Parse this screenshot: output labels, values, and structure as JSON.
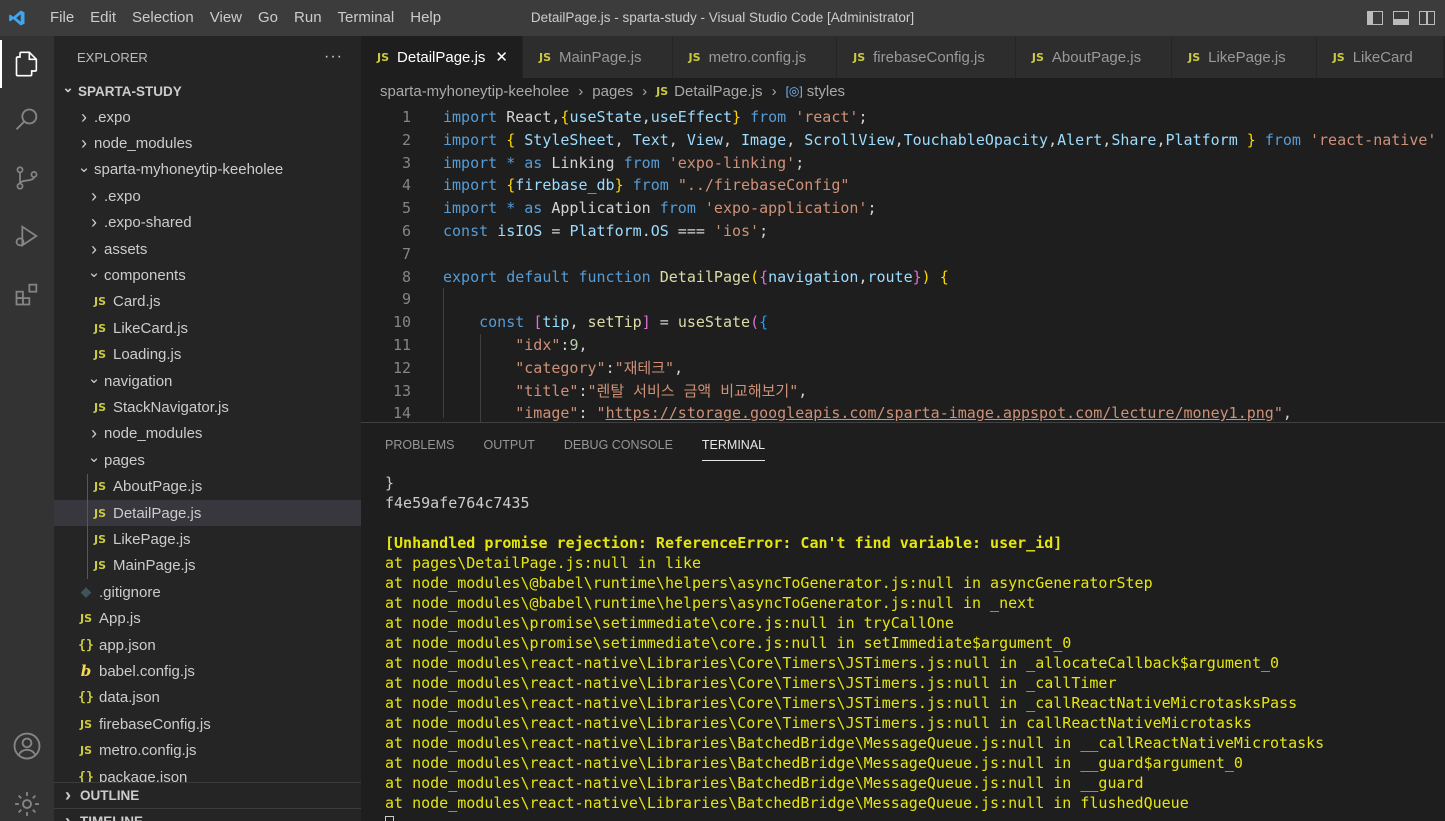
{
  "window": {
    "title": "DetailPage.js - sparta-study - Visual Studio Code [Administrator]",
    "menu": [
      "File",
      "Edit",
      "Selection",
      "View",
      "Go",
      "Run",
      "Terminal",
      "Help"
    ]
  },
  "explorer": {
    "header": "EXPLORER",
    "more": "···",
    "root": "SPARTA-STUDY",
    "items": [
      {
        "label": ".expo",
        "type": "folder"
      },
      {
        "label": "node_modules",
        "type": "folder"
      },
      {
        "label": "sparta-myhoneytip-keeholee",
        "type": "folder-open"
      },
      {
        "label": ".expo",
        "type": "folder"
      },
      {
        "label": ".expo-shared",
        "type": "folder"
      },
      {
        "label": "assets",
        "type": "folder"
      },
      {
        "label": "components",
        "type": "folder-open"
      },
      {
        "label": "Card.js",
        "type": "js"
      },
      {
        "label": "LikeCard.js",
        "type": "js"
      },
      {
        "label": "Loading.js",
        "type": "js"
      },
      {
        "label": "navigation",
        "type": "folder-open"
      },
      {
        "label": "StackNavigator.js",
        "type": "js"
      },
      {
        "label": "node_modules",
        "type": "folder"
      },
      {
        "label": "pages",
        "type": "folder-open"
      },
      {
        "label": "AboutPage.js",
        "type": "js"
      },
      {
        "label": "DetailPage.js",
        "type": "js"
      },
      {
        "label": "LikePage.js",
        "type": "js"
      },
      {
        "label": "MainPage.js",
        "type": "js"
      },
      {
        "label": ".gitignore",
        "type": "git"
      },
      {
        "label": "App.js",
        "type": "js"
      },
      {
        "label": "app.json",
        "type": "json"
      },
      {
        "label": "babel.config.js",
        "type": "babel"
      },
      {
        "label": "data.json",
        "type": "json"
      },
      {
        "label": "firebaseConfig.js",
        "type": "js"
      },
      {
        "label": "metro.config.js",
        "type": "js"
      },
      {
        "label": "package.json",
        "type": "json"
      }
    ],
    "outline": "OUTLINE",
    "timeline": "TIMELINE"
  },
  "tabs": [
    {
      "label": "DetailPage.js",
      "icon": "JS",
      "close": "✕"
    },
    {
      "label": "MainPage.js",
      "icon": "JS"
    },
    {
      "label": "metro.config.js",
      "icon": "JS"
    },
    {
      "label": "firebaseConfig.js",
      "icon": "JS"
    },
    {
      "label": "AboutPage.js",
      "icon": "JS"
    },
    {
      "label": "LikePage.js",
      "icon": "JS"
    },
    {
      "label": "LikeCard",
      "icon": "JS"
    }
  ],
  "breadcrumb": {
    "folder": "sparta-myhoneytip-keeholee",
    "subfolder": "pages",
    "file_icon": "JS",
    "file": "DetailPage.js",
    "symbol": "styles"
  },
  "code": {
    "line_numbers": [
      "1",
      "2",
      "3",
      "4",
      "5",
      "6",
      "7",
      "8",
      "9",
      "10",
      "11",
      "12",
      "13",
      "14"
    ],
    "lines": [
      [
        [
          "kw",
          "import"
        ],
        [
          "plain",
          " React,"
        ],
        [
          "brk1",
          "{"
        ],
        [
          "var",
          "useState"
        ],
        [
          "plain",
          ","
        ],
        [
          "var",
          "useEffect"
        ],
        [
          "brk1",
          "}"
        ],
        [
          "plain",
          " "
        ],
        [
          "kw",
          "from"
        ],
        [
          "plain",
          " "
        ],
        [
          "str",
          "'react'"
        ],
        [
          "plain",
          ";"
        ]
      ],
      [
        [
          "kw",
          "import"
        ],
        [
          "plain",
          " "
        ],
        [
          "brk1",
          "{"
        ],
        [
          "plain",
          " "
        ],
        [
          "var",
          "StyleSheet"
        ],
        [
          "plain",
          ", "
        ],
        [
          "var",
          "Text"
        ],
        [
          "plain",
          ", "
        ],
        [
          "var",
          "View"
        ],
        [
          "plain",
          ", "
        ],
        [
          "var",
          "Image"
        ],
        [
          "plain",
          ", "
        ],
        [
          "var",
          "ScrollView"
        ],
        [
          "plain",
          ","
        ],
        [
          "var",
          "TouchableOpacity"
        ],
        [
          "plain",
          ","
        ],
        [
          "var",
          "Alert"
        ],
        [
          "plain",
          ","
        ],
        [
          "var",
          "Share"
        ],
        [
          "plain",
          ","
        ],
        [
          "var",
          "Platform"
        ],
        [
          "plain",
          " "
        ],
        [
          "brk1",
          "}"
        ],
        [
          "plain",
          " "
        ],
        [
          "kw",
          "from"
        ],
        [
          "plain",
          " "
        ],
        [
          "str",
          "'react-native'"
        ]
      ],
      [
        [
          "kw",
          "import"
        ],
        [
          "plain",
          " "
        ],
        [
          "kw",
          "*"
        ],
        [
          "plain",
          " "
        ],
        [
          "kw",
          "as"
        ],
        [
          "plain",
          " Linking "
        ],
        [
          "kw",
          "from"
        ],
        [
          "plain",
          " "
        ],
        [
          "str",
          "'expo-linking'"
        ],
        [
          "plain",
          ";"
        ]
      ],
      [
        [
          "kw",
          "import"
        ],
        [
          "plain",
          " "
        ],
        [
          "brk1",
          "{"
        ],
        [
          "var",
          "firebase_db"
        ],
        [
          "brk1",
          "}"
        ],
        [
          "plain",
          " "
        ],
        [
          "kw",
          "from"
        ],
        [
          "plain",
          " "
        ],
        [
          "str",
          "\"../firebaseConfig\""
        ]
      ],
      [
        [
          "kw",
          "import"
        ],
        [
          "plain",
          " "
        ],
        [
          "kw",
          "*"
        ],
        [
          "plain",
          " "
        ],
        [
          "kw",
          "as"
        ],
        [
          "plain",
          " Application "
        ],
        [
          "kw",
          "from"
        ],
        [
          "plain",
          " "
        ],
        [
          "str",
          "'expo-application'"
        ],
        [
          "plain",
          ";"
        ]
      ],
      [
        [
          "kw",
          "const"
        ],
        [
          "plain",
          " "
        ],
        [
          "var",
          "isIOS"
        ],
        [
          "plain",
          " = "
        ],
        [
          "var",
          "Platform"
        ],
        [
          "plain",
          "."
        ],
        [
          "var",
          "OS"
        ],
        [
          "plain",
          " === "
        ],
        [
          "str",
          "'ios'"
        ],
        [
          "plain",
          ";"
        ]
      ],
      [],
      [
        [
          "kw",
          "export"
        ],
        [
          "plain",
          " "
        ],
        [
          "kw",
          "default"
        ],
        [
          "plain",
          " "
        ],
        [
          "kw",
          "function"
        ],
        [
          "plain",
          " "
        ],
        [
          "fn",
          "DetailPage"
        ],
        [
          "brk1",
          "("
        ],
        [
          "brk2",
          "{"
        ],
        [
          "var",
          "navigation"
        ],
        [
          "plain",
          ","
        ],
        [
          "var",
          "route"
        ],
        [
          "brk2",
          "}"
        ],
        [
          "brk1",
          ")"
        ],
        [
          "plain",
          " "
        ],
        [
          "brk1",
          "{"
        ]
      ],
      [],
      [
        [
          "plain",
          "    "
        ],
        [
          "kw",
          "const"
        ],
        [
          "plain",
          " "
        ],
        [
          "brk2",
          "["
        ],
        [
          "var",
          "tip"
        ],
        [
          "plain",
          ", "
        ],
        [
          "fn",
          "setTip"
        ],
        [
          "brk2",
          "]"
        ],
        [
          "plain",
          " = "
        ],
        [
          "fn",
          "useState"
        ],
        [
          "brk2",
          "("
        ],
        [
          "brk3",
          "{"
        ]
      ],
      [
        [
          "plain",
          "        "
        ],
        [
          "str",
          "\"idx\""
        ],
        [
          "plain",
          ":"
        ],
        [
          "num",
          "9"
        ],
        [
          "plain",
          ","
        ]
      ],
      [
        [
          "plain",
          "        "
        ],
        [
          "str",
          "\"category\""
        ],
        [
          "plain",
          ":"
        ],
        [
          "str",
          "\"재테크\""
        ],
        [
          "plain",
          ","
        ]
      ],
      [
        [
          "plain",
          "        "
        ],
        [
          "str",
          "\"title\""
        ],
        [
          "plain",
          ":"
        ],
        [
          "str",
          "\"렌탈 서비스 금액 비교해보기\""
        ],
        [
          "plain",
          ","
        ]
      ],
      [
        [
          "plain",
          "        "
        ],
        [
          "str",
          "\"image\""
        ],
        [
          "plain",
          ": "
        ],
        [
          "str",
          "\""
        ],
        [
          "url",
          "https://storage.googleapis.com/sparta-image.appspot.com/lecture/money1.png"
        ],
        [
          "str",
          "\""
        ],
        [
          "plain",
          ","
        ]
      ]
    ]
  },
  "panel": {
    "tabs": [
      "PROBLEMS",
      "OUTPUT",
      "DEBUG CONSOLE",
      "TERMINAL"
    ],
    "active_tab": "TERMINAL",
    "terminal_lines": [
      {
        "text": "}",
        "style": "white"
      },
      {
        "text": "f4e59afe764c7435",
        "style": "white"
      },
      {
        "text": "",
        "style": "white"
      },
      {
        "text": "[Unhandled promise rejection: ReferenceError: Can't find variable: user_id]",
        "style": "yellow bold"
      },
      {
        "text": "at pages\\DetailPage.js:null in like",
        "style": "yellow"
      },
      {
        "text": "at node_modules\\@babel\\runtime\\helpers\\asyncToGenerator.js:null in asyncGeneratorStep",
        "style": "yellow"
      },
      {
        "text": "at node_modules\\@babel\\runtime\\helpers\\asyncToGenerator.js:null in _next",
        "style": "yellow"
      },
      {
        "text": "at node_modules\\promise\\setimmediate\\core.js:null in tryCallOne",
        "style": "yellow"
      },
      {
        "text": "at node_modules\\promise\\setimmediate\\core.js:null in setImmediate$argument_0",
        "style": "yellow"
      },
      {
        "text": "at node_modules\\react-native\\Libraries\\Core\\Timers\\JSTimers.js:null in _allocateCallback$argument_0",
        "style": "yellow"
      },
      {
        "text": "at node_modules\\react-native\\Libraries\\Core\\Timers\\JSTimers.js:null in _callTimer",
        "style": "yellow"
      },
      {
        "text": "at node_modules\\react-native\\Libraries\\Core\\Timers\\JSTimers.js:null in _callReactNativeMicrotasksPass",
        "style": "yellow"
      },
      {
        "text": "at node_modules\\react-native\\Libraries\\Core\\Timers\\JSTimers.js:null in callReactNativeMicrotasks",
        "style": "yellow"
      },
      {
        "text": "at node_modules\\react-native\\Libraries\\BatchedBridge\\MessageQueue.js:null in __callReactNativeMicrotasks",
        "style": "yellow"
      },
      {
        "text": "at node_modules\\react-native\\Libraries\\BatchedBridge\\MessageQueue.js:null in __guard$argument_0",
        "style": "yellow"
      },
      {
        "text": "at node_modules\\react-native\\Libraries\\BatchedBridge\\MessageQueue.js:null in __guard",
        "style": "yellow"
      },
      {
        "text": "at node_modules\\react-native\\Libraries\\BatchedBridge\\MessageQueue.js:null in flushedQueue",
        "style": "yellow"
      }
    ]
  },
  "colors": {
    "accent": "#0078d4",
    "activity_bar": "#333333",
    "sidebar": "#252526",
    "editor": "#1e1e1e",
    "terminal_warning": "#e5e510"
  },
  "icons": {
    "activity": [
      "files-icon",
      "search-icon",
      "source-control-icon",
      "run-debug-icon",
      "extensions-icon",
      "account-icon",
      "settings-gear-icon"
    ],
    "layout": [
      "toggle-sidebar-icon",
      "toggle-panel-icon",
      "split-layout-icon"
    ]
  }
}
